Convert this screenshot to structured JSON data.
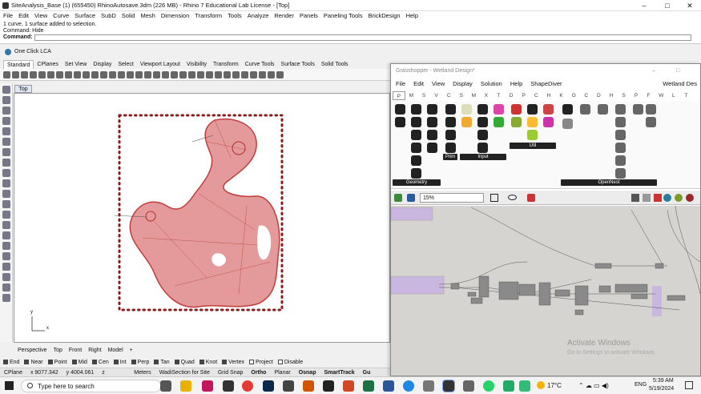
{
  "window": {
    "title": "SiteAnalysis_Base (1) (655450) RhinoAutosave.3dm (226 MB) - Rhino 7 Educational Lab License - [Top]"
  },
  "menu": [
    "File",
    "Edit",
    "View",
    "Curve",
    "Surface",
    "SubD",
    "Solid",
    "Mesh",
    "Dimension",
    "Transform",
    "Tools",
    "Analyze",
    "Render",
    "Panels",
    "Paneling Tools",
    "BrickDesign",
    "Help"
  ],
  "command": {
    "history": [
      "1 curve, 1 surface added to selection.",
      "Command: Hide"
    ],
    "prompt": "Command:"
  },
  "plugin_bar": {
    "label": "One Click LCA"
  },
  "toolbar_tabs": [
    "Standard",
    "CPlanes",
    "Set View",
    "Display",
    "Select",
    "Viewport Layout",
    "Visibility",
    "Transform",
    "Curve Tools",
    "Surface Tools",
    "Solid Tools"
  ],
  "viewport": {
    "label": "Top",
    "axis_x": "x",
    "axis_y": "y"
  },
  "view_tabs": [
    "Perspective",
    "Top",
    "Front",
    "Right",
    "Model"
  ],
  "osnaps": [
    {
      "label": "End",
      "on": true
    },
    {
      "label": "Near",
      "on": true
    },
    {
      "label": "Point",
      "on": true
    },
    {
      "label": "Mid",
      "on": true
    },
    {
      "label": "Cen",
      "on": true
    },
    {
      "label": "Int",
      "on": true
    },
    {
      "label": "Perp",
      "on": true
    },
    {
      "label": "Tan",
      "on": true
    },
    {
      "label": "Quad",
      "on": true
    },
    {
      "label": "Knot",
      "on": true
    },
    {
      "label": "Vertex",
      "on": true
    },
    {
      "label": "Project",
      "on": false
    },
    {
      "label": "Disable",
      "on": false
    }
  ],
  "status": {
    "cplane": "CPlane",
    "x": "x 9077.342",
    "y": "y 4004.061",
    "z": "z",
    "units": "Meters",
    "layer": "WadiSection for Site",
    "items": [
      "Grid Snap",
      "Ortho",
      "Planar",
      "Osnap",
      "SmartTrack",
      "Gu"
    ]
  },
  "taskbar": {
    "search": "Type here to search",
    "weather": "17°C",
    "lang": "ENG",
    "time": "5:39 AM",
    "date": "5/19/2024"
  },
  "grasshopper": {
    "title": "Grasshopper - Wetland Design*",
    "menu": [
      "File",
      "Edit",
      "View",
      "Display",
      "Solution",
      "Help",
      "ShapeDiver"
    ],
    "doc_name": "Wetland Des",
    "categories": [
      "P",
      "M",
      "S",
      "V",
      "C",
      "S",
      "M",
      "X",
      "T",
      "D",
      "P",
      "C",
      "H",
      "K",
      "O",
      "C",
      "D",
      "H",
      "S",
      "P",
      "F",
      "W",
      "L",
      "T"
    ],
    "groups": [
      "Geometry",
      "Prim",
      "Input",
      "Util",
      "OpenNest"
    ],
    "zoom": "15%",
    "watermark": "Activate Windows",
    "watermark_sub": "Go to Settings to activate Windows."
  }
}
